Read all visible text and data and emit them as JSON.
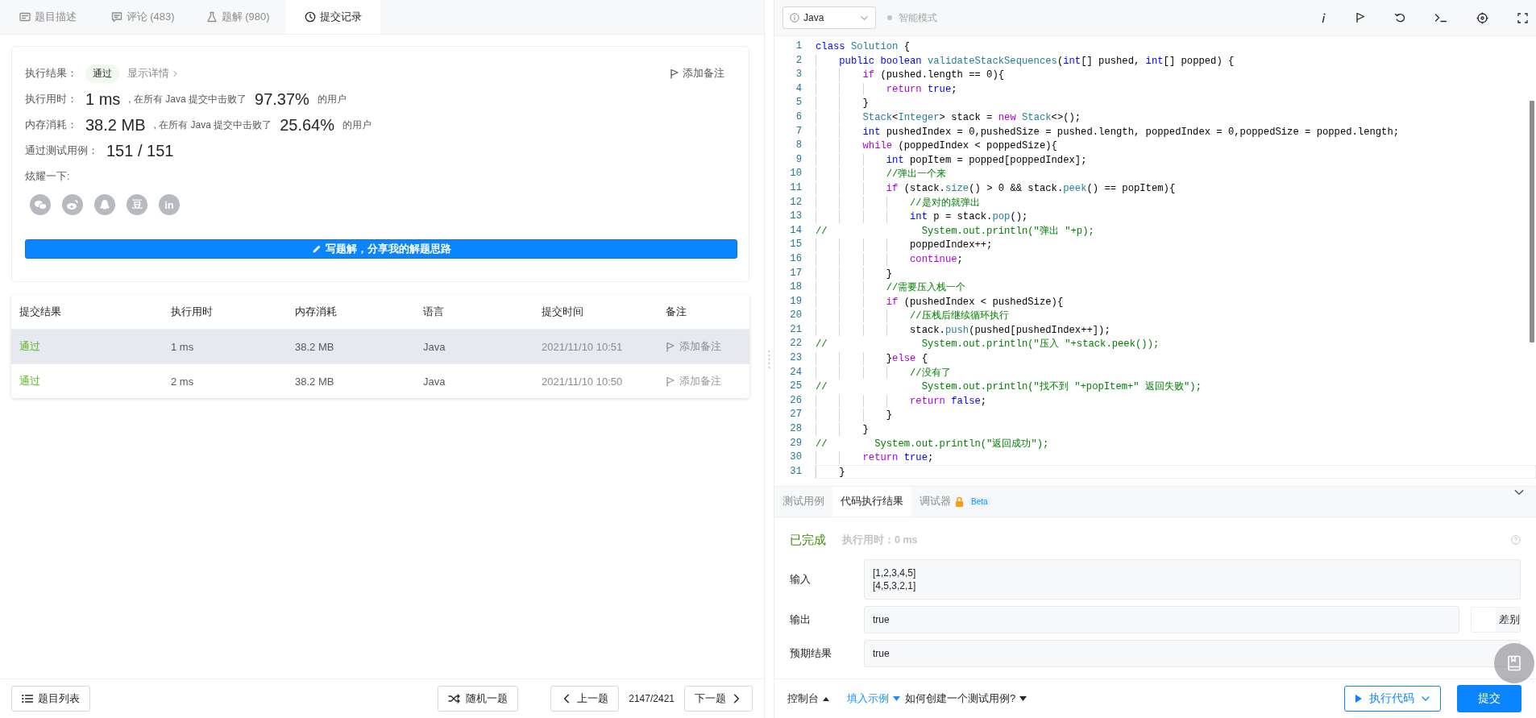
{
  "left_tabs": [
    {
      "kind": "description",
      "label": "题目描述",
      "selected": false
    },
    {
      "kind": "comments",
      "label": "评论 (483)",
      "selected": false
    },
    {
      "kind": "solutions",
      "label": "题解 (980)",
      "selected": false
    },
    {
      "kind": "submissions",
      "label": "提交记录",
      "selected": true
    }
  ],
  "result": {
    "label": "执行结果：",
    "status": "通过",
    "details_link": "显示详情",
    "note_button": "添加备注",
    "stats": [
      {
        "label": "执行用时：",
        "value": "1 ms",
        "text": ", 在所有 Java 提交中击败了",
        "percent": "97.37%",
        "suffix": "的用户"
      },
      {
        "label": "内存消耗：",
        "value": "38.2 MB",
        "text": ", 在所有 Java 提交中击败了",
        "percent": "25.64%",
        "suffix": "的用户"
      }
    ],
    "testcases_label": "通过测试用例：",
    "testcases_value": "151 / 151",
    "share_label": "炫耀一下:",
    "share_buttons": [
      {
        "kind": "chat"
      },
      {
        "kind": "swirl"
      },
      {
        "kind": "penguin"
      },
      {
        "kind": "text",
        "text": "豆"
      },
      {
        "kind": "text",
        "text": "in"
      }
    ],
    "write_button": "写题解，分享我的解题思路"
  },
  "submissions": {
    "columns": [
      "提交结果",
      "执行用时",
      "内存消耗",
      "语言",
      "提交时间",
      "备注"
    ],
    "rows": [
      {
        "selected": true,
        "status": "通过",
        "time": "1 ms",
        "memory": "38.2 MB",
        "language": "Java",
        "submitted": "2021/11/10 10:51",
        "note": "添加备注"
      },
      {
        "selected": false,
        "status": "通过",
        "time": "2 ms",
        "memory": "38.2 MB",
        "language": "Java",
        "submitted": "2021/11/10 10:50",
        "note": "添加备注"
      }
    ]
  },
  "left_footer": {
    "list_button": "题目列表",
    "random_button": "随机一题",
    "prev_button": "上一题",
    "position": "2147/2421",
    "next_button": "下一题"
  },
  "editor_toolbar": {
    "language": "Java",
    "smart_mode": {
      "label": "智能模式",
      "on": false
    }
  },
  "code_lines": [
    {
      "number": "1",
      "active": false,
      "segments": [
        {
          "text": "class",
          "kind": "type"
        },
        {
          "text": " Solution",
          "kind": "cls"
        },
        {
          "text": " {",
          "kind": "plain"
        }
      ]
    },
    {
      "number": "2",
      "active": false,
      "segments": [
        {
          "text": "    public",
          "kind": "type"
        },
        {
          "text": " boolean",
          "kind": "type"
        },
        {
          "text": " validateStackSequences",
          "kind": "fn"
        },
        {
          "text": "(",
          "kind": "plain"
        },
        {
          "text": "int",
          "kind": "type"
        },
        {
          "text": "[] pushed, ",
          "kind": "plain"
        },
        {
          "text": "int",
          "kind": "type"
        },
        {
          "text": "[] popped) {",
          "kind": "plain"
        }
      ]
    },
    {
      "number": "3",
      "active": false,
      "segments": [
        {
          "text": "        if",
          "kind": "kw"
        },
        {
          "text": " (pushed.length == 0){",
          "kind": "plain"
        }
      ]
    },
    {
      "number": "4",
      "active": false,
      "segments": [
        {
          "text": "            return",
          "kind": "kw"
        },
        {
          "text": " true",
          "kind": "type"
        },
        {
          "text": ";",
          "kind": "plain"
        }
      ]
    },
    {
      "number": "5",
      "active": false,
      "segments": [
        {
          "text": "        }",
          "kind": "plain"
        }
      ]
    },
    {
      "number": "6",
      "active": false,
      "segments": [
        {
          "text": "        Stack",
          "kind": "cls"
        },
        {
          "text": "<",
          "kind": "plain"
        },
        {
          "text": "Integer",
          "kind": "cls"
        },
        {
          "text": "> stack = ",
          "kind": "plain"
        },
        {
          "text": "new",
          "kind": "kw"
        },
        {
          "text": " Stack",
          "kind": "cls"
        },
        {
          "text": "<>();",
          "kind": "plain"
        }
      ]
    },
    {
      "number": "7",
      "active": false,
      "segments": [
        {
          "text": "        int",
          "kind": "type"
        },
        {
          "text": " pushedIndex = 0,pushedSize = pushed.length, poppedIndex = 0,poppedSize = popped.length;",
          "kind": "plain"
        }
      ]
    },
    {
      "number": "8",
      "active": false,
      "segments": [
        {
          "text": "        while",
          "kind": "kw"
        },
        {
          "text": " (poppedIndex < poppedSize){",
          "kind": "plain"
        }
      ]
    },
    {
      "number": "9",
      "active": false,
      "segments": [
        {
          "text": "            int",
          "kind": "type"
        },
        {
          "text": " popItem = popped[poppedIndex];",
          "kind": "plain"
        }
      ]
    },
    {
      "number": "10",
      "active": false,
      "segments": [
        {
          "text": "            //弹出一个来",
          "kind": "cm"
        }
      ]
    },
    {
      "number": "11",
      "active": false,
      "segments": [
        {
          "text": "            if",
          "kind": "kw"
        },
        {
          "text": " (stack.",
          "kind": "plain"
        },
        {
          "text": "size",
          "kind": "fn"
        },
        {
          "text": "() > 0 && stack.",
          "kind": "plain"
        },
        {
          "text": "peek",
          "kind": "fn"
        },
        {
          "text": "() == popItem){",
          "kind": "plain"
        }
      ]
    },
    {
      "number": "12",
      "active": false,
      "segments": [
        {
          "text": "                //是对的就弹出",
          "kind": "cm"
        }
      ]
    },
    {
      "number": "13",
      "active": false,
      "segments": [
        {
          "text": "                int",
          "kind": "type"
        },
        {
          "text": " p = stack.",
          "kind": "plain"
        },
        {
          "text": "pop",
          "kind": "fn"
        },
        {
          "text": "();",
          "kind": "plain"
        }
      ]
    },
    {
      "number": "14",
      "active": false,
      "segments": [
        {
          "text": "//                System.out.println(\"弹出 \"+p);",
          "kind": "cm"
        }
      ]
    },
    {
      "number": "15",
      "active": false,
      "segments": [
        {
          "text": "                poppedIndex++;",
          "kind": "plain"
        }
      ]
    },
    {
      "number": "16",
      "active": false,
      "segments": [
        {
          "text": "                continue",
          "kind": "kw"
        },
        {
          "text": ";",
          "kind": "plain"
        }
      ]
    },
    {
      "number": "17",
      "active": false,
      "segments": [
        {
          "text": "            }",
          "kind": "plain"
        }
      ]
    },
    {
      "number": "18",
      "active": false,
      "segments": [
        {
          "text": "            //需要压入栈一个",
          "kind": "cm"
        }
      ]
    },
    {
      "number": "19",
      "active": false,
      "segments": [
        {
          "text": "            if",
          "kind": "kw"
        },
        {
          "text": " (pushedIndex < pushedSize){",
          "kind": "plain"
        }
      ]
    },
    {
      "number": "20",
      "active": false,
      "segments": [
        {
          "text": "                //压栈后继续循环执行",
          "kind": "cm"
        }
      ]
    },
    {
      "number": "21",
      "active": false,
      "segments": [
        {
          "text": "                stack.",
          "kind": "plain"
        },
        {
          "text": "push",
          "kind": "fn"
        },
        {
          "text": "(pushed[pushedIndex++]);",
          "kind": "plain"
        }
      ]
    },
    {
      "number": "22",
      "active": false,
      "segments": [
        {
          "text": "//                System.out.println(\"压入 \"+stack.peek());",
          "kind": "cm"
        }
      ]
    },
    {
      "number": "23",
      "active": false,
      "segments": [
        {
          "text": "            }",
          "kind": "plain"
        },
        {
          "text": "else",
          "kind": "kw"
        },
        {
          "text": " {",
          "kind": "plain"
        }
      ]
    },
    {
      "number": "24",
      "active": false,
      "segments": [
        {
          "text": "                //没有了",
          "kind": "cm"
        }
      ]
    },
    {
      "number": "25",
      "active": false,
      "segments": [
        {
          "text": "//                System.out.println(\"找不到 \"+popItem+\" 返回失败\");",
          "kind": "cm"
        }
      ]
    },
    {
      "number": "26",
      "active": false,
      "segments": [
        {
          "text": "                return",
          "kind": "kw"
        },
        {
          "text": " false",
          "kind": "type"
        },
        {
          "text": ";",
          "kind": "plain"
        }
      ]
    },
    {
      "number": "27",
      "active": false,
      "segments": [
        {
          "text": "            }",
          "kind": "plain"
        }
      ]
    },
    {
      "number": "28",
      "active": false,
      "segments": [
        {
          "text": "        }",
          "kind": "plain"
        }
      ]
    },
    {
      "number": "29",
      "active": false,
      "segments": [
        {
          "text": "//        System.out.println(\"返回成功\");",
          "kind": "cm"
        }
      ]
    },
    {
      "number": "30",
      "active": false,
      "segments": [
        {
          "text": "        return",
          "kind": "kw"
        },
        {
          "text": " true",
          "kind": "type"
        },
        {
          "text": ";",
          "kind": "plain"
        }
      ]
    },
    {
      "number": "31",
      "active": true,
      "segments": [
        {
          "text": "    }",
          "kind": "plain"
        }
      ]
    }
  ],
  "console_tabs": [
    {
      "label": "测试用例",
      "selected": false
    },
    {
      "label": "代码执行结果",
      "selected": true
    },
    {
      "label": "调试器",
      "selected": false,
      "locked": true,
      "badge": "Beta"
    }
  ],
  "run_result": {
    "status": "已完成",
    "runtime": "执行用时：0 ms",
    "input_label": "输入",
    "input_lines": [
      "[1,2,3,4,5]",
      "[4,5,3,2,1]"
    ],
    "output_label": "输出",
    "output": "true",
    "diff": {
      "label": "差别",
      "on": false
    },
    "expected_label": "预期结果",
    "expected": "true"
  },
  "console_footer": {
    "console_button": "控制台",
    "fill_example": "填入示例",
    "help_link": "如何创建一个测试用例?",
    "run_button": "执行代码",
    "submit_button": "提交"
  }
}
